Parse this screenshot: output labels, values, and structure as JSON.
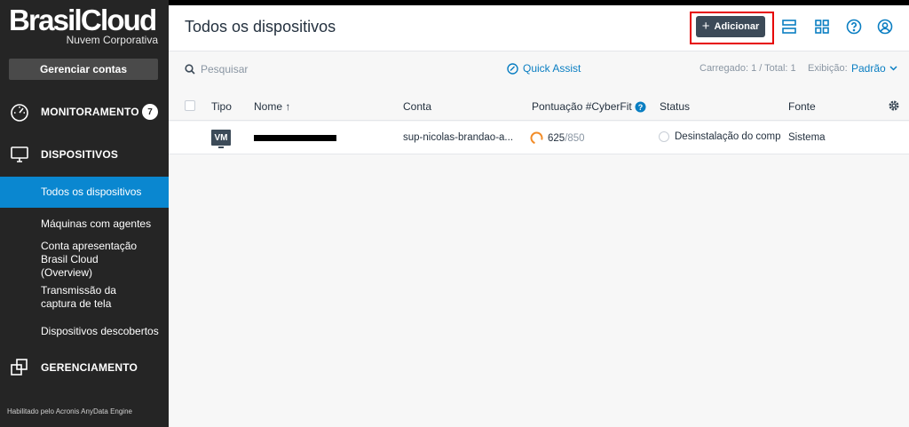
{
  "sidebar": {
    "brand_name": "BrasilCloud",
    "brand_sub": "Nuvem Corporativa",
    "manage_label": "Gerenciar contas",
    "sections": {
      "monitoring": {
        "label": "MONITORAMENTO",
        "badge": "7"
      },
      "devices": {
        "label": "DISPOSITIVOS"
      },
      "management": {
        "label": "GERENCIAMENTO"
      }
    },
    "items": [
      {
        "label": "Todos os dispositivos"
      },
      {
        "label": "Máquinas com agentes"
      },
      {
        "label": "Conta apresentação Brasil Cloud (Overview)"
      },
      {
        "label": "Transmissão da captura de tela"
      },
      {
        "label": "Dispositivos descobertos"
      }
    ],
    "footer": "Habilitado pelo Acronis AnyData Engine"
  },
  "header": {
    "title": "Todos os dispositivos",
    "add_label": "Adicionar"
  },
  "toolbar": {
    "search_placeholder": "Pesquisar",
    "quick_assist": "Quick Assist",
    "loaded": "Carregado: 1 / Total: 1",
    "view_label": "Exibição:",
    "view_value": "Padrão"
  },
  "table": {
    "columns": {
      "type": "Tipo",
      "name": "Nome ↑",
      "account": "Conta",
      "score": "Pontuação #CyberFit",
      "status": "Status",
      "source": "Fonte"
    },
    "rows": [
      {
        "type": "VM",
        "account": "sup-nicolas-brandao-a...",
        "score": "625",
        "score_total": "/850",
        "status": "Desinstalação do comp",
        "source": "Sistema"
      }
    ]
  },
  "colors": {
    "sidebar_bg": "#252525",
    "active_item": "#0a87d0",
    "accent_link": "#0a7ec2",
    "add_button": "#3c4a58",
    "highlight": "#e60000",
    "score_ring": "#f28c28"
  }
}
